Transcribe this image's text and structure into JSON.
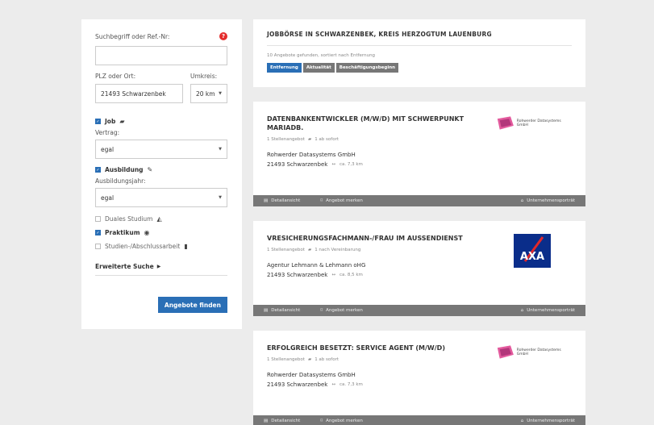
{
  "search": {
    "keyword_label": "Suchbegriff oder Ref.-Nr:",
    "keyword_value": "",
    "help_icon": "?",
    "location_label": "PLZ oder Ort:",
    "location_value": "21493 Schwarzenbek",
    "radius_label": "Umkreis:",
    "radius_value": "20 km",
    "job_label": "Job",
    "contract_label": "Vertrag:",
    "contract_value": "egal",
    "apprenticeship_label": "Ausbildung",
    "apprenticeship_year_label": "Ausbildungsjahr:",
    "apprenticeship_year_value": "egal",
    "dual_study_label": "Duales Studium",
    "internship_label": "Praktikum",
    "thesis_label": "Studien-/Abschlussarbeit",
    "advanced_label": "Erweiterte Suche",
    "submit_label": "Angebote finden"
  },
  "results": {
    "title": "JOBBÖRSE IN SCHWARZENBEK, KREIS HERZOGTUM LAUENBURG",
    "summary": "10 Angebote gefunden, sortiert nach Entfernung",
    "sort": [
      {
        "label": "Entfernung",
        "active": true
      },
      {
        "label": "Aktualität",
        "active": false
      },
      {
        "label": "Beschäftigungsbeginn",
        "active": false
      }
    ]
  },
  "jobs": [
    {
      "title": "DATENBANKENTWICKLER (M/W/D) MIT SCHWERPUNKT MARIADB.",
      "positions": "1 Stellenangebot",
      "start": "1 ab sofort",
      "company": "Rohwerder Datasystems GmbH",
      "location": "21493 Schwarzenbek",
      "distance": "ca. 7,3 km",
      "logo": "Rohwerder Datasystems GmbH"
    },
    {
      "title": "VRESICHERUNGSFACHMANN-/FRAU IM AUSSENDIENST",
      "positions": "1 Stellenangebot",
      "start": "1 nach Vereinbarung",
      "company": "Agentur Lehmann & Lehmann oHG",
      "location": "21493 Schwarzenbek",
      "distance": "ca. 8,5 km",
      "logo": "AXA"
    },
    {
      "title": "ERFOLGREICH BESETZT: SERVICE AGENT (M/W/D)",
      "positions": "1 Stellenangebot",
      "start": "1 ab sofort",
      "company": "Rohwerder Datasystems GmbH",
      "location": "21493 Schwarzenbek",
      "distance": "ca. 7,3 km",
      "logo": "Rohwerder Datasystems GmbH"
    }
  ],
  "footer": {
    "details": "Detailansicht",
    "bookmark": "Angebot merken",
    "portrait": "Unternehmensporträt"
  },
  "colors": {
    "accent": "#2a6fb6",
    "footer_bar": "#777777",
    "help": "#e42c2c"
  }
}
